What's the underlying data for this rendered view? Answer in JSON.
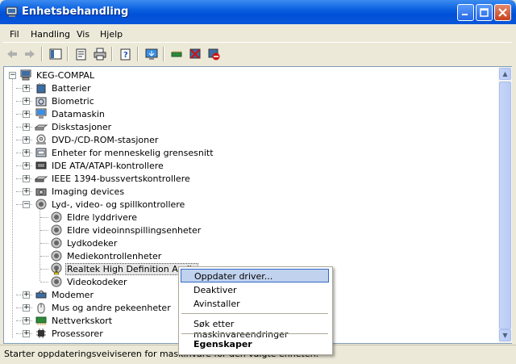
{
  "window": {
    "title": "Enhetsbehandling",
    "minimize": "_",
    "maximize": "□",
    "close": "✕"
  },
  "menu": [
    "Fil",
    "Handling",
    "Vis",
    "Hjelp"
  ],
  "tree": {
    "root": "KEG-COMPAL",
    "categories": [
      "Batterier",
      "Biometric",
      "Datamaskin",
      "Diskstasjoner",
      "DVD-/CD-ROM-stasjoner",
      "Enheter for menneskelig grensesnitt",
      "IDE ATA/ATAPI-kontrollere",
      "IEEE 1394-bussvertskontrollere",
      "Imaging devices",
      "Lyd-, video- og spillkontrollere"
    ],
    "audio_children": [
      "Eldre lyddrivere",
      "Eldre videoinnspillingsenheter",
      "Lydkodeker",
      "Mediekontrollenheter",
      "Realtek High Definition Audio",
      "Videokodeker"
    ],
    "after": [
      "Modemer",
      "Mus og andre pekeenheter",
      "Nettverkskort",
      "Prosessorer"
    ]
  },
  "context_menu": {
    "update": "Oppdater driver...",
    "disable": "Deaktiver",
    "uninstall": "Avinstaller",
    "scan": "Søk etter maskinvareendringer",
    "properties": "Egenskaper"
  },
  "status": "Starter oppdateringsveiviseren for maskinvare for den valgte enheten."
}
